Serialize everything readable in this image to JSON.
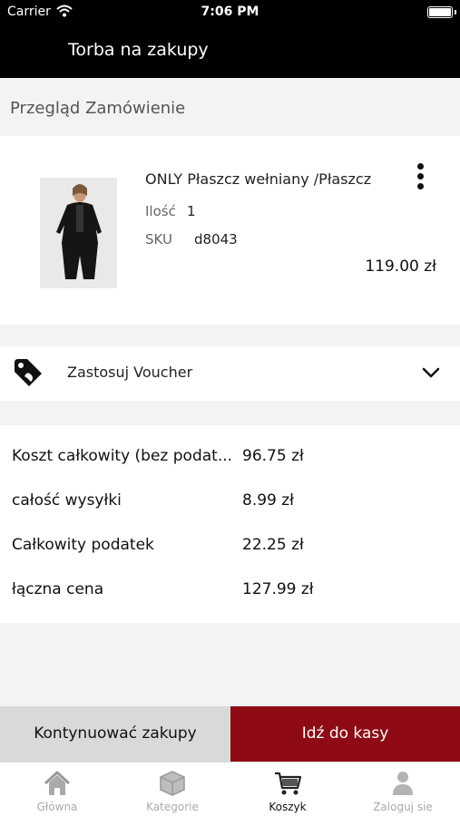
{
  "status_bar": {
    "carrier": "Carrier",
    "time": "7:06 PM"
  },
  "nav": {
    "title": "Torba na zakupy"
  },
  "section": {
    "title": "Przegląd Zamówienie"
  },
  "product": {
    "name": "ONLY Płaszcz wełniany /Płaszcz",
    "qty_label": "Ilość",
    "qty_value": "1",
    "sku_label": "SKU",
    "sku_value": "d8043",
    "price": "119.00 zł"
  },
  "voucher": {
    "label": "Zastosuj Voucher"
  },
  "totals": [
    {
      "label": "Koszt całkowity (bez podat...",
      "value": "96.75 zł"
    },
    {
      "label": "całość wysyłki",
      "value": "8.99 zł"
    },
    {
      "label": "Całkowity podatek",
      "value": "22.25 zł"
    },
    {
      "label": "łączna cena",
      "value": "127.99 zł"
    }
  ],
  "actions": {
    "continue": "Kontynuować zakupy",
    "checkout": "Idź do kasy"
  },
  "tabs": [
    {
      "label": "Główna",
      "icon": "home-icon"
    },
    {
      "label": "Kategorie",
      "icon": "cube-icon"
    },
    {
      "label": "Koszyk",
      "icon": "cart-icon"
    },
    {
      "label": "Zaloguj sie",
      "icon": "user-icon"
    }
  ],
  "colors": {
    "accent": "#8e0b15",
    "header": "#000000",
    "background": "#f3f3f3"
  }
}
